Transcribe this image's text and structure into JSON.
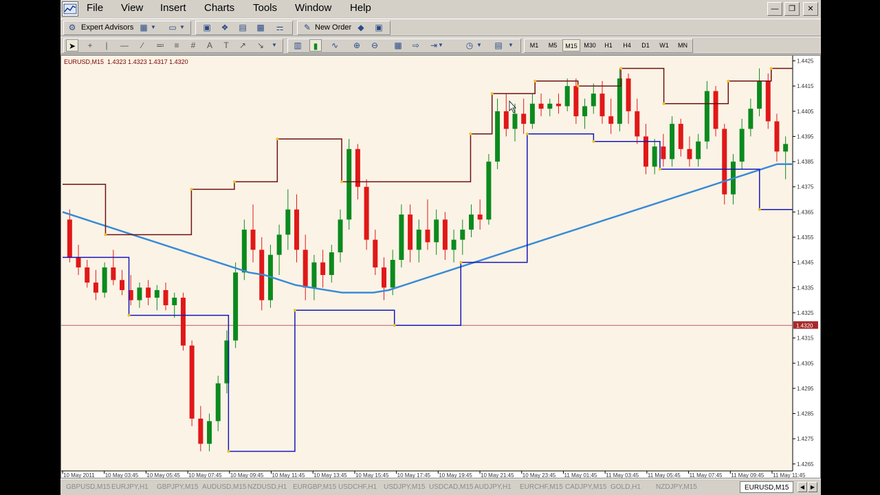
{
  "menu": {
    "items": [
      "File",
      "View",
      "Insert",
      "Charts",
      "Tools",
      "Window",
      "Help"
    ]
  },
  "toolbar": {
    "expert_advisors_label": "Expert Advisors",
    "new_order_label": "New Order",
    "timeframes": [
      "M1",
      "M5",
      "M15",
      "M30",
      "H1",
      "H4",
      "D1",
      "W1",
      "MN"
    ],
    "active_timeframe": "M15"
  },
  "chart": {
    "symbol_label": "EURUSD,M15",
    "ohlc": "1.4323 1.4323 1.4317 1.4320",
    "current_price_label": "1.4320",
    "colors": {
      "background": "#fbf3e6",
      "bull": "#0b8a1e",
      "bear": "#e01818",
      "ma": "#3a8ad6",
      "upper": "#6e1010",
      "lower": "#1616b8",
      "price_line": "#b86060"
    }
  },
  "chart_data": {
    "type": "line",
    "title": "EURUSD,M15",
    "y_ticks": [
      "1.4425",
      "1.4415",
      "1.4405",
      "1.4395",
      "1.4385",
      "1.4375",
      "1.4365",
      "1.4355",
      "1.4345",
      "1.4335",
      "1.4325",
      "1.4315",
      "1.4305",
      "1.4295",
      "1.4285",
      "1.4275",
      "1.4265"
    ],
    "ylim": [
      1.42625,
      1.44265
    ],
    "x_ticks": [
      "10 May 2011",
      "10 May 03:45",
      "10 May 05:45",
      "10 May 07:45",
      "10 May 09:45",
      "10 May 11:45",
      "10 May 13:45",
      "10 May 15:45",
      "10 May 17:45",
      "10 May 19:45",
      "10 May 21:45",
      "10 May 23:45",
      "11 May 01:45",
      "11 May 03:45",
      "11 May 05:45",
      "11 May 07:45",
      "11 May 09:45",
      "11 May 11:45"
    ],
    "current_price": 1.432,
    "candles": [
      [
        1.4362,
        1.4366,
        1.4345,
        1.4347
      ],
      [
        1.4347,
        1.4352,
        1.434,
        1.4343
      ],
      [
        1.4343,
        1.4346,
        1.4335,
        1.4337
      ],
      [
        1.4337,
        1.4342,
        1.433,
        1.4333
      ],
      [
        1.4333,
        1.4345,
        1.4331,
        1.4343
      ],
      [
        1.4343,
        1.435,
        1.4336,
        1.4338
      ],
      [
        1.4338,
        1.4342,
        1.4332,
        1.4334
      ],
      [
        1.4334,
        1.434,
        1.4328,
        1.433
      ],
      [
        1.433,
        1.4337,
        1.4327,
        1.4335
      ],
      [
        1.4335,
        1.4338,
        1.4328,
        1.4331
      ],
      [
        1.4331,
        1.4336,
        1.4326,
        1.4334
      ],
      [
        1.4334,
        1.4337,
        1.4326,
        1.4328
      ],
      [
        1.4328,
        1.4333,
        1.4323,
        1.4331
      ],
      [
        1.4331,
        1.4333,
        1.431,
        1.4312
      ],
      [
        1.4312,
        1.4314,
        1.428,
        1.4283
      ],
      [
        1.4283,
        1.4288,
        1.427,
        1.4273
      ],
      [
        1.4273,
        1.4285,
        1.427,
        1.4282
      ],
      [
        1.4282,
        1.43,
        1.4278,
        1.4297
      ],
      [
        1.4297,
        1.4318,
        1.4293,
        1.4314
      ],
      [
        1.4314,
        1.4345,
        1.4311,
        1.4341
      ],
      [
        1.4341,
        1.4362,
        1.4338,
        1.4358
      ],
      [
        1.4358,
        1.4368,
        1.4345,
        1.435
      ],
      [
        1.435,
        1.4355,
        1.4326,
        1.433
      ],
      [
        1.433,
        1.4352,
        1.4327,
        1.4348
      ],
      [
        1.4348,
        1.436,
        1.434,
        1.4356
      ],
      [
        1.4356,
        1.4374,
        1.435,
        1.4366
      ],
      [
        1.4366,
        1.4372,
        1.4345,
        1.435
      ],
      [
        1.435,
        1.4356,
        1.433,
        1.4335
      ],
      [
        1.4335,
        1.4348,
        1.433,
        1.4345
      ],
      [
        1.4345,
        1.435,
        1.4335,
        1.434
      ],
      [
        1.434,
        1.4352,
        1.4337,
        1.4349
      ],
      [
        1.4349,
        1.4366,
        1.4345,
        1.4362
      ],
      [
        1.4362,
        1.4394,
        1.4358,
        1.439
      ],
      [
        1.439,
        1.4392,
        1.437,
        1.4375
      ],
      [
        1.4375,
        1.4378,
        1.435,
        1.4354
      ],
      [
        1.4354,
        1.4358,
        1.434,
        1.4343
      ],
      [
        1.4343,
        1.4347,
        1.433,
        1.4335
      ],
      [
        1.4335,
        1.435,
        1.4332,
        1.4346
      ],
      [
        1.4346,
        1.4368,
        1.4343,
        1.4364
      ],
      [
        1.4364,
        1.4368,
        1.4345,
        1.435
      ],
      [
        1.435,
        1.4362,
        1.4345,
        1.4358
      ],
      [
        1.4358,
        1.437,
        1.435,
        1.4353
      ],
      [
        1.4353,
        1.4366,
        1.4348,
        1.4362
      ],
      [
        1.4362,
        1.4365,
        1.4346,
        1.435
      ],
      [
        1.435,
        1.4358,
        1.4345,
        1.4354
      ],
      [
        1.4354,
        1.4362,
        1.4348,
        1.4358
      ],
      [
        1.4358,
        1.4368,
        1.4355,
        1.4364
      ],
      [
        1.4364,
        1.437,
        1.4358,
        1.4362
      ],
      [
        1.4362,
        1.4388,
        1.436,
        1.4385
      ],
      [
        1.4385,
        1.441,
        1.4382,
        1.4405
      ],
      [
        1.4405,
        1.4412,
        1.4395,
        1.4398
      ],
      [
        1.4398,
        1.4408,
        1.4393,
        1.4404
      ],
      [
        1.4404,
        1.441,
        1.4396,
        1.44
      ],
      [
        1.44,
        1.4412,
        1.4398,
        1.4408
      ],
      [
        1.4408,
        1.4412,
        1.4403,
        1.4406
      ],
      [
        1.4406,
        1.441,
        1.4403,
        1.4408
      ],
      [
        1.4408,
        1.4412,
        1.4404,
        1.4407
      ],
      [
        1.4407,
        1.4418,
        1.4405,
        1.4415
      ],
      [
        1.4415,
        1.4418,
        1.44,
        1.4403
      ],
      [
        1.4403,
        1.441,
        1.4398,
        1.4407
      ],
      [
        1.4407,
        1.4416,
        1.4404,
        1.4412
      ],
      [
        1.4412,
        1.4417,
        1.44,
        1.4403
      ],
      [
        1.4403,
        1.441,
        1.4396,
        1.44
      ],
      [
        1.44,
        1.4422,
        1.4397,
        1.4418
      ],
      [
        1.4418,
        1.442,
        1.44,
        1.4405
      ],
      [
        1.4405,
        1.441,
        1.4392,
        1.4395
      ],
      [
        1.4395,
        1.44,
        1.438,
        1.4383
      ],
      [
        1.4383,
        1.4394,
        1.438,
        1.4391
      ],
      [
        1.4391,
        1.4396,
        1.4383,
        1.4386
      ],
      [
        1.4386,
        1.4403,
        1.4383,
        1.44
      ],
      [
        1.44,
        1.4402,
        1.4387,
        1.439
      ],
      [
        1.439,
        1.4395,
        1.4383,
        1.4386
      ],
      [
        1.4386,
        1.4396,
        1.4383,
        1.4393
      ],
      [
        1.4393,
        1.4417,
        1.439,
        1.4413
      ],
      [
        1.4413,
        1.4415,
        1.4395,
        1.4398
      ],
      [
        1.4398,
        1.44,
        1.4368,
        1.4372
      ],
      [
        1.4372,
        1.4388,
        1.4368,
        1.4385
      ],
      [
        1.4385,
        1.4402,
        1.4382,
        1.4398
      ],
      [
        1.4398,
        1.441,
        1.4395,
        1.4406
      ],
      [
        1.4406,
        1.4422,
        1.4403,
        1.4417
      ],
      [
        1.4417,
        1.442,
        1.4398,
        1.4401
      ],
      [
        1.4401,
        1.4404,
        1.4385,
        1.4389
      ],
      [
        1.4389,
        1.4395,
        1.4378,
        1.4392
      ]
    ],
    "series": [
      {
        "values": [
          1.4365,
          1.4363,
          1.4361,
          1.4359,
          1.4357,
          1.4355,
          1.4353,
          1.4351,
          1.4349,
          1.4347,
          1.4345,
          1.4343,
          1.4341,
          1.434,
          1.4338,
          1.4336,
          1.4335,
          1.4334,
          1.4333,
          1.4333,
          1.4333,
          1.4334,
          1.4336,
          1.4338,
          1.434,
          1.4342,
          1.4344,
          1.4346,
          1.4348,
          1.435,
          1.4352,
          1.4354,
          1.4356,
          1.4358,
          1.436,
          1.4362,
          1.4364,
          1.4366,
          1.4368,
          1.437,
          1.4372,
          1.4374,
          1.4376,
          1.4378,
          1.438,
          1.4382,
          1.4384,
          1.4384
        ]
      },
      {
        "values": [
          1.4376,
          1.4376,
          1.4356,
          1.4356,
          1.4356,
          1.4356,
          1.4374,
          1.4374,
          1.4377,
          1.4377,
          1.4394,
          1.4394,
          1.4394,
          1.4377,
          1.4377,
          1.4377,
          1.4377,
          1.4377,
          1.4377,
          1.4396,
          1.4412,
          1.4412,
          1.4417,
          1.4417,
          1.4415,
          1.4415,
          1.4422,
          1.4422,
          1.4408,
          1.4408,
          1.4408,
          1.4417,
          1.4417,
          1.4422,
          1.4422
        ]
      },
      {
        "values": [
          1.4347,
          1.4347,
          1.4324,
          1.4324,
          1.4324,
          1.427,
          1.427,
          1.4326,
          1.4326,
          1.4326,
          1.432,
          1.432,
          1.4345,
          1.4345,
          1.4396,
          1.4396,
          1.4393,
          1.4393,
          1.4382,
          1.4382,
          1.4382,
          1.4366,
          1.4366
        ]
      }
    ]
  },
  "bottom": {
    "active_tab": "EURUSD,M15",
    "other_tabs": [
      "GBPUSD,M15",
      "EURJPY,H1",
      "GBPJPY,M15",
      "AUDUSD,M15",
      "NZDUSD,H1",
      "EURGBP,M15",
      "USDCHF,H1",
      "USDJPY,M15",
      "USDCAD,M15",
      "AUDJPY,H1",
      "EURCHF,M15",
      "CADJPY,M15",
      "GOLD,H1",
      "NZDJPY,M15"
    ]
  }
}
